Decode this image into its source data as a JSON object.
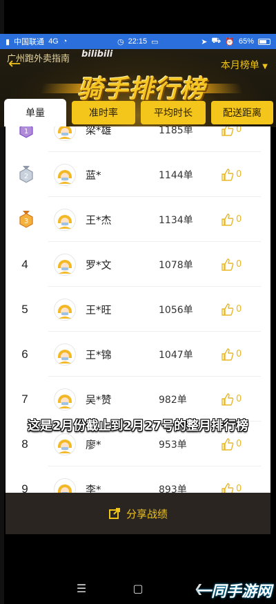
{
  "status_bar": {
    "carrier": "中国联通",
    "network": "4G",
    "time": "22:15",
    "battery": "65%"
  },
  "header": {
    "subtitle": "广州跑外卖指南",
    "watermark_logo": "bilibili",
    "month_selector": "本月榜单",
    "title": "骑手排行榜",
    "accent_color": "#f0c419"
  },
  "tabs": [
    {
      "label": "单量",
      "active": true
    },
    {
      "label": "准时率",
      "active": false
    },
    {
      "label": "平均时长",
      "active": false
    },
    {
      "label": "配送距离",
      "active": false
    }
  ],
  "rows": [
    {
      "rank": "1",
      "medal": "gold",
      "name": "梁*雄",
      "orders": "1185单",
      "likes": "0"
    },
    {
      "rank": "2",
      "medal": "silver",
      "name": "蓝*",
      "orders": "1144单",
      "likes": "0"
    },
    {
      "rank": "3",
      "medal": "bronze",
      "name": "王*杰",
      "orders": "1134单",
      "likes": "0"
    },
    {
      "rank": "4",
      "medal": "",
      "name": "罗*文",
      "orders": "1078单",
      "likes": "0"
    },
    {
      "rank": "5",
      "medal": "",
      "name": "王*旺",
      "orders": "1056单",
      "likes": "0"
    },
    {
      "rank": "6",
      "medal": "",
      "name": "王*锦",
      "orders": "1047单",
      "likes": "0"
    },
    {
      "rank": "7",
      "medal": "",
      "name": "吴*赞",
      "orders": "982单",
      "likes": "0"
    },
    {
      "rank": "8",
      "medal": "",
      "name": "廖*",
      "orders": "953单",
      "likes": "0"
    },
    {
      "rank": "9",
      "medal": "",
      "name": "李*",
      "orders": "893单",
      "likes": "0"
    }
  ],
  "caption": "这是2月份截止到2月27号的整月排行榜",
  "share": {
    "label": "分享战绩",
    "icon": "share-icon"
  },
  "corner_watermark": "一同手游网"
}
